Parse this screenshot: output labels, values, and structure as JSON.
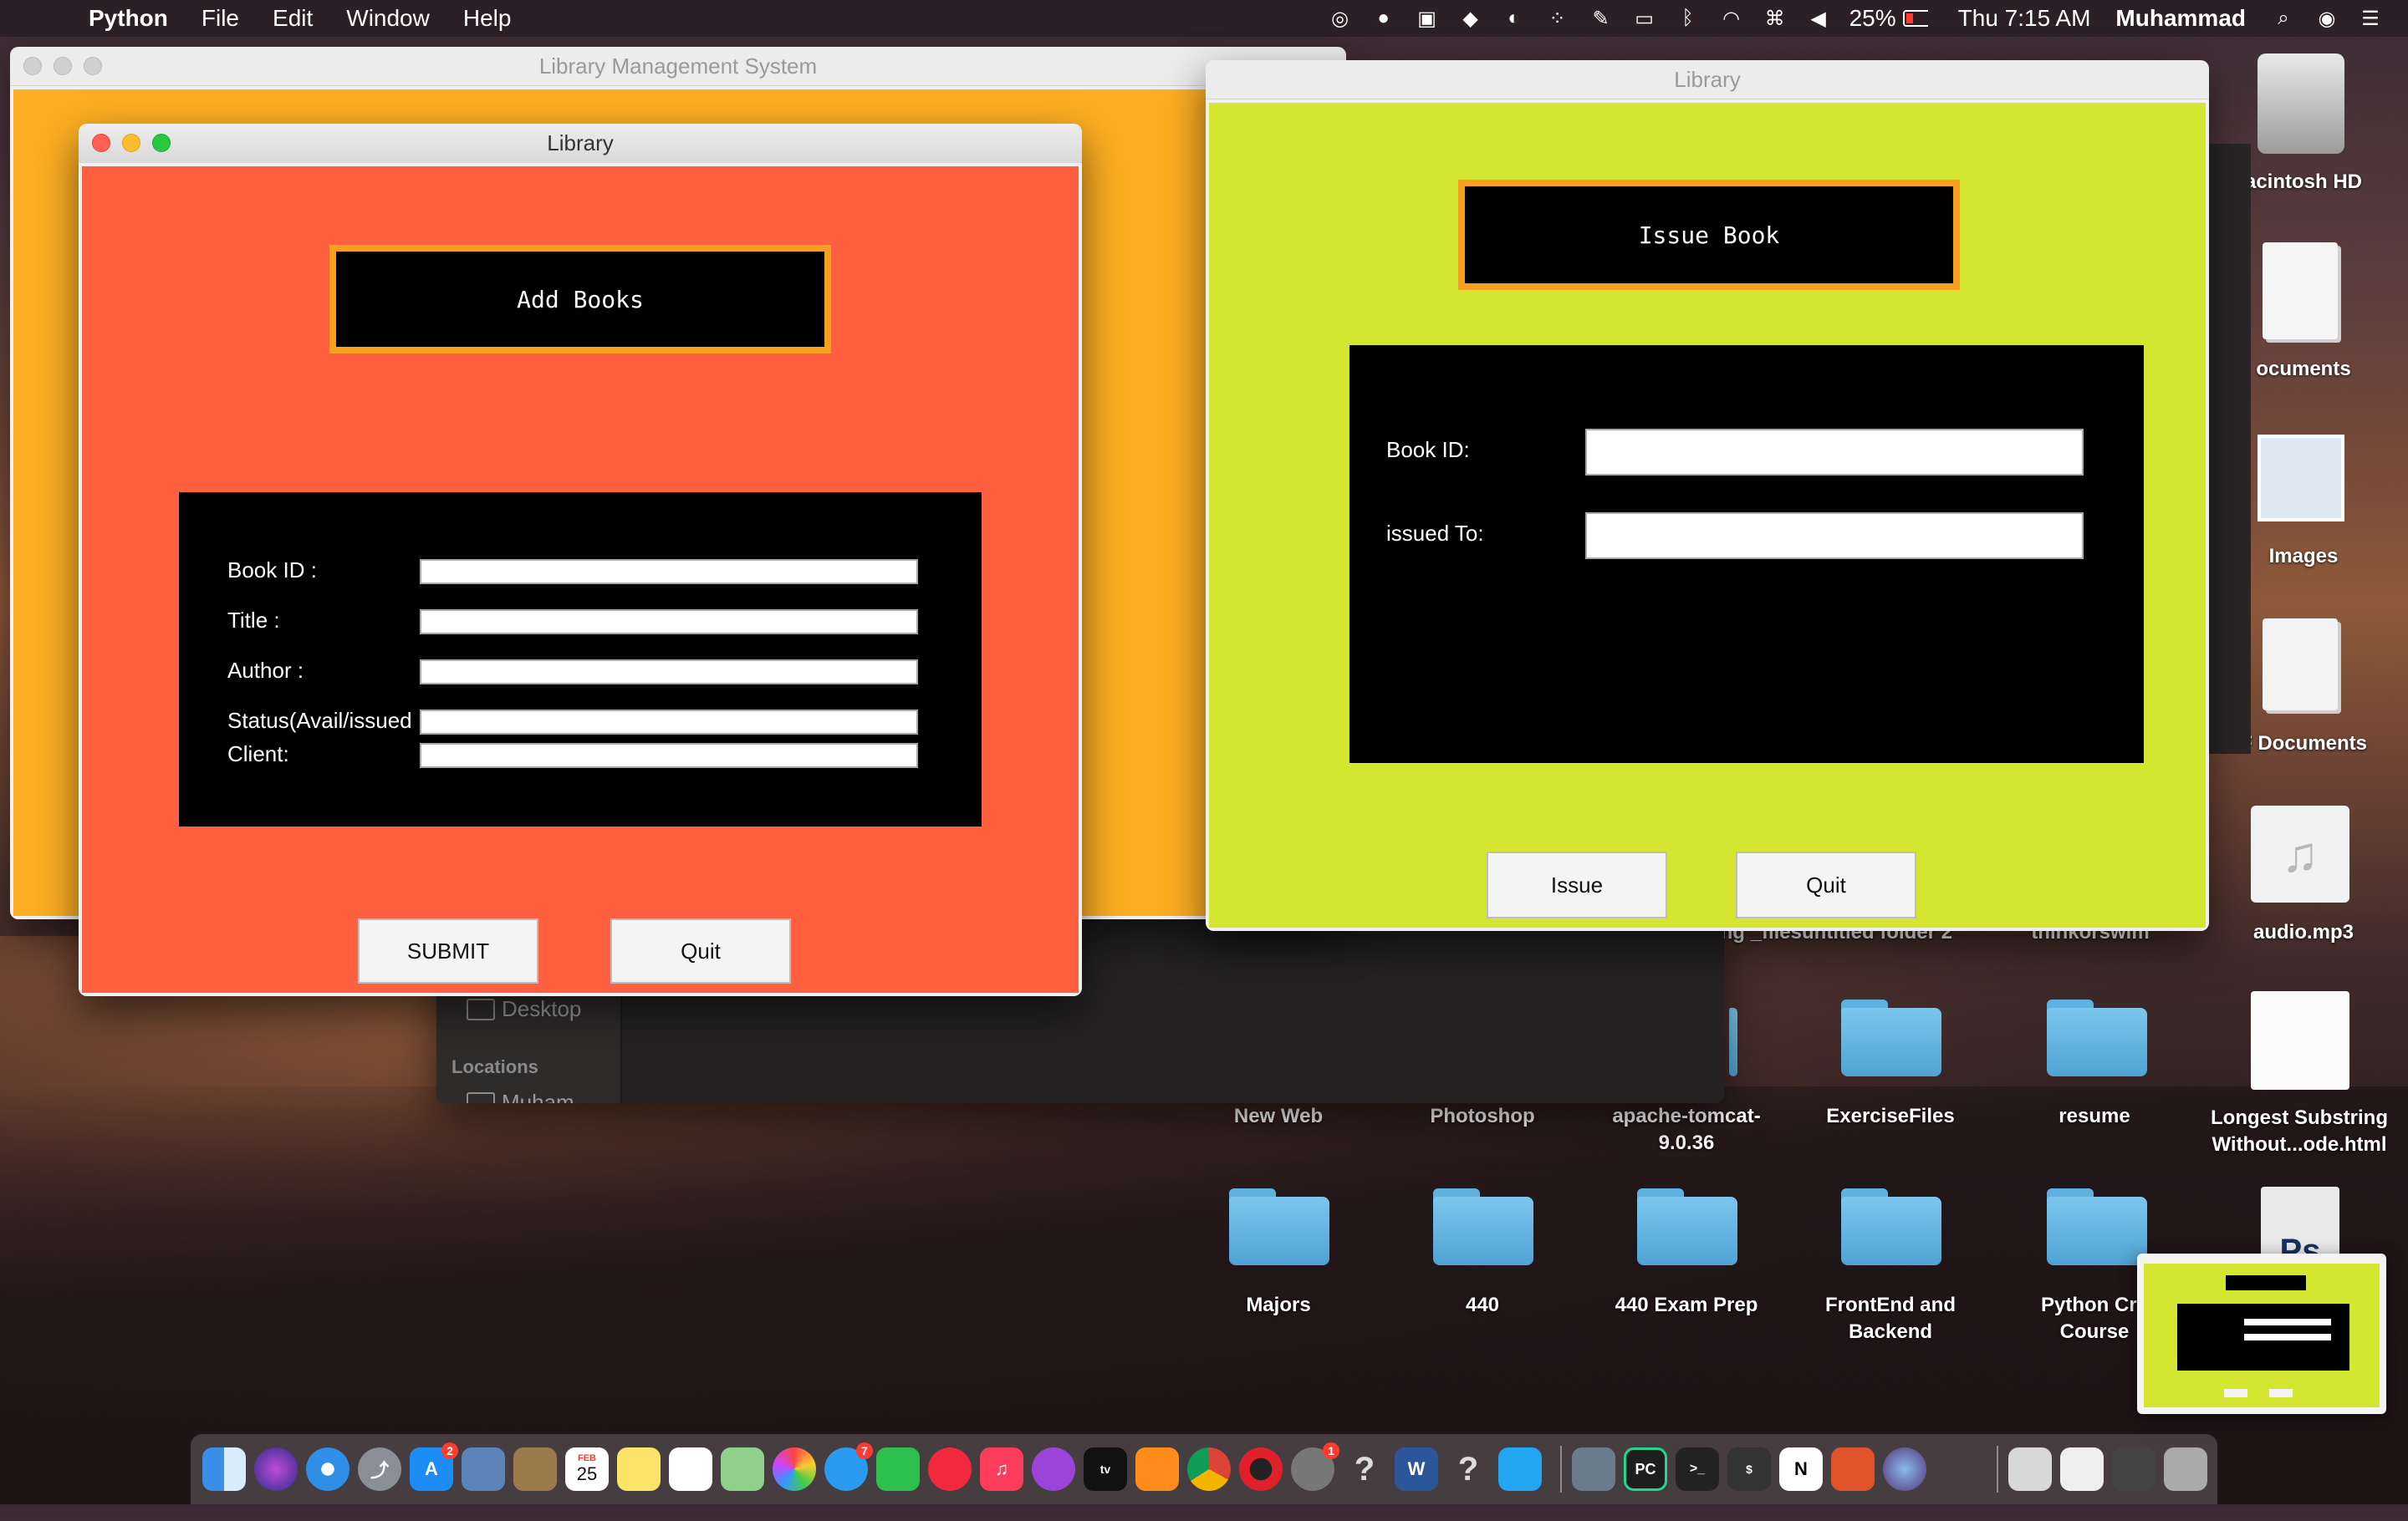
{
  "menubar": {
    "app_name": "Python",
    "menus": [
      "File",
      "Edit",
      "Window",
      "Help"
    ],
    "battery": "25%",
    "clock": "Thu 7:15 AM",
    "user": "Muhammad"
  },
  "windows": {
    "lms": {
      "title": "Library Management System",
      "color": "#fdae22"
    },
    "add_books": {
      "title": "Library",
      "bg_color": "#ff6040",
      "heading": "Add Books",
      "fields": [
        {
          "label": "Book ID :",
          "value": ""
        },
        {
          "label": "Title :",
          "value": ""
        },
        {
          "label": "Author :",
          "value": ""
        },
        {
          "label": "Status(Avail/issued",
          "value": ""
        },
        {
          "label": "Client:",
          "value": ""
        }
      ],
      "submit_label": "SUBMIT",
      "quit_label": "Quit"
    },
    "issue_book": {
      "title": "Library",
      "bg_color": "#d5e630",
      "heading": "Issue Book",
      "fields": [
        {
          "label": "Book ID:",
          "value": ""
        },
        {
          "label": "issued To:",
          "value": ""
        }
      ],
      "issue_label": "Issue",
      "quit_label": "Quit"
    },
    "finder": {
      "sidebar": [
        "Desktop"
      ],
      "section_label": "Locations",
      "partial_item": "Muham"
    }
  },
  "desktop": {
    "right_column": [
      "acintosh HD",
      "ocuments",
      "Images",
      "F Documents",
      "audio.mp3",
      "Longest Substring Without...ode.html"
    ],
    "partial_labels": [
      "string _files",
      "untitled folder 2",
      "thinkorswim"
    ],
    "row1": [
      "New Web",
      "Photoshop",
      "apache-tomcat-9.0.36",
      "ExerciseFiles",
      "resume"
    ],
    "row2": [
      "Majors",
      "440",
      "440 Exam Prep",
      "FrontEnd and Backend",
      "Python Cra Course"
    ]
  },
  "dock": {
    "calendar_month": "FEB",
    "calendar_day": "25",
    "app_store_badge": "2",
    "messages_badge": "7",
    "sysprefs_badge": "1"
  }
}
